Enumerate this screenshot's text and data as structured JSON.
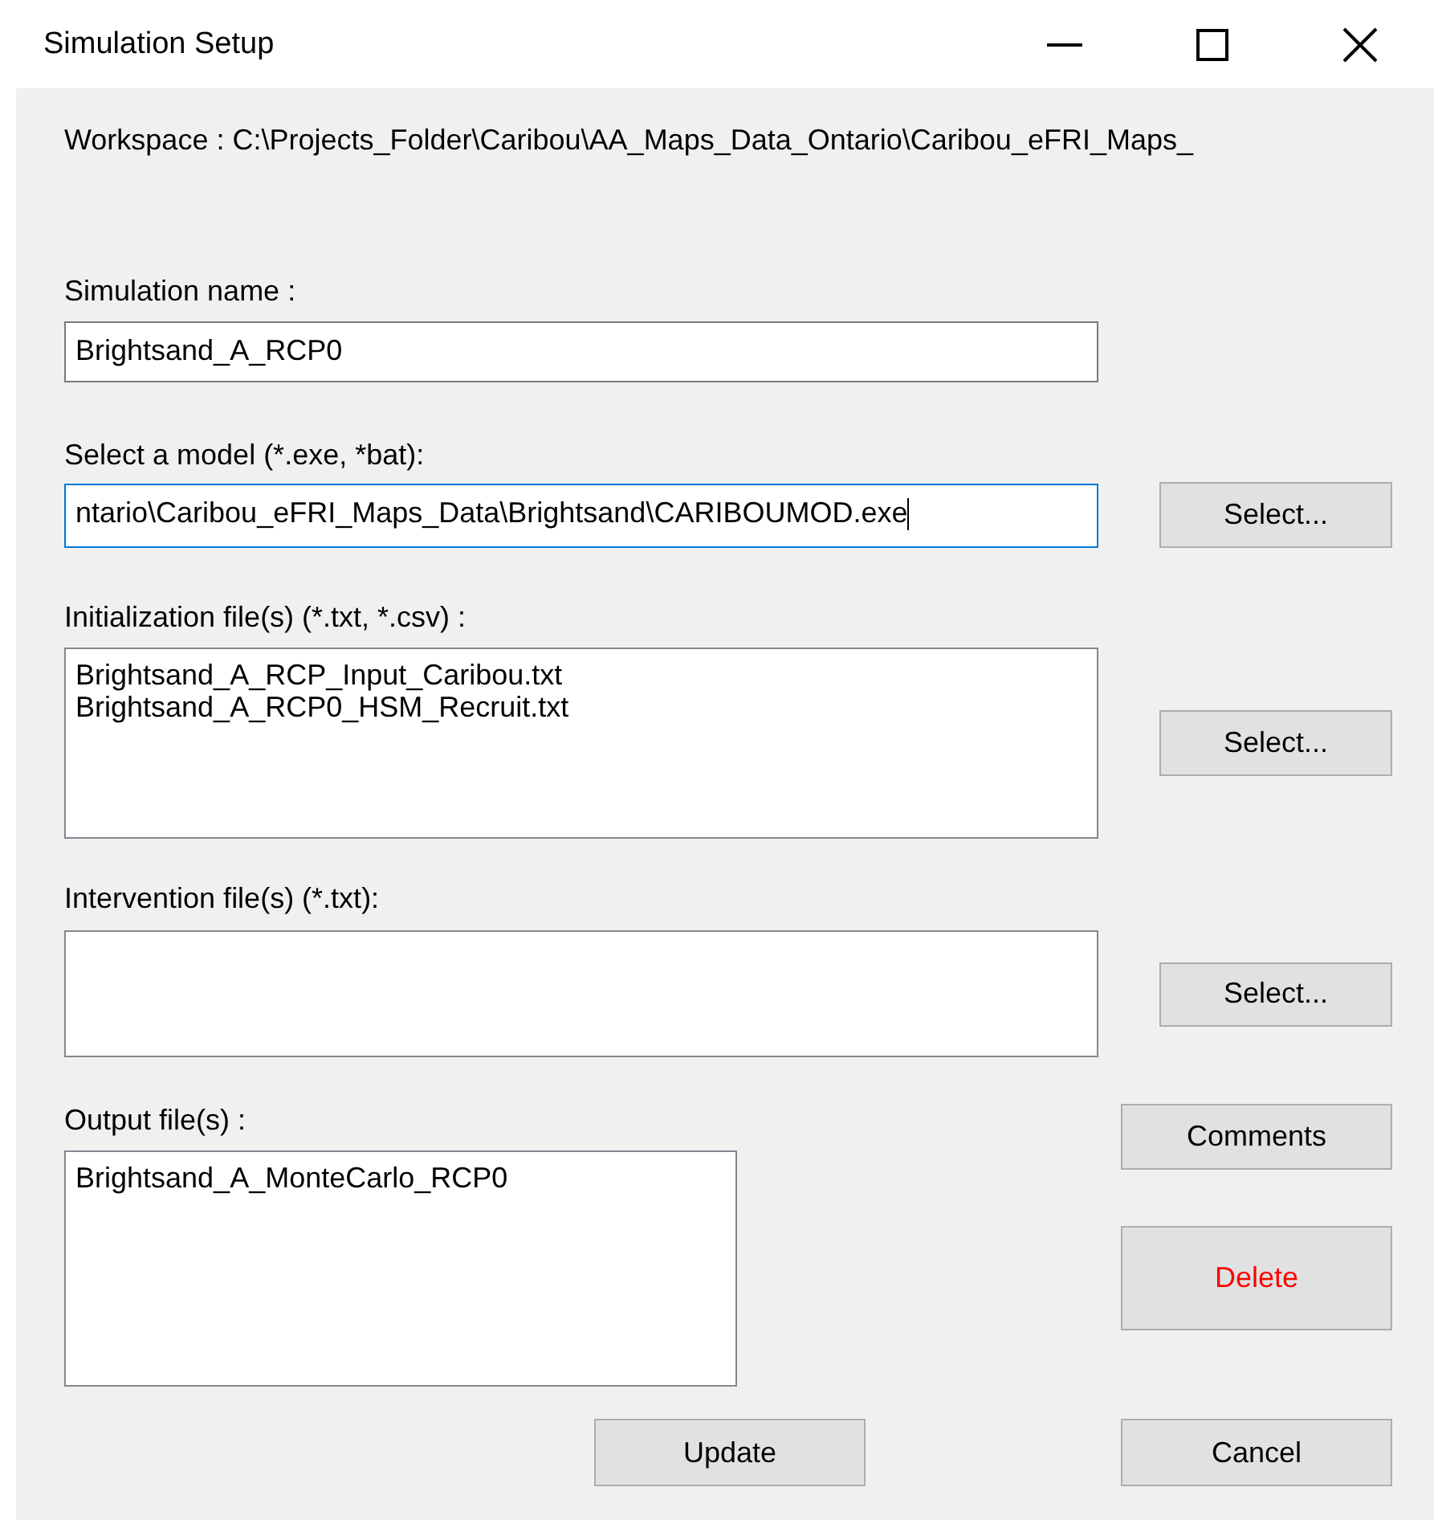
{
  "window": {
    "title": "Simulation Setup"
  },
  "workspace": "Workspace : C:\\Projects_Folder\\Caribou\\AA_Maps_Data_Ontario\\Caribou_eFRI_Maps_",
  "simulation_name": {
    "label": "Simulation name :",
    "value": "Brightsand_A_RCP0",
    "focused": false
  },
  "model": {
    "label": "Select a model (*.exe, *bat):",
    "value": "ntario\\Caribou_eFRI_Maps_Data\\Brightsand\\CARIBOUMOD.exe",
    "focused": true,
    "button": "Select..."
  },
  "initialization": {
    "label": "Initialization file(s) (*.txt, *.csv) :",
    "items": [
      "Brightsand_A_RCP_Input_Caribou.txt",
      "Brightsand_A_RCP0_HSM_Recruit.txt"
    ],
    "button": "Select..."
  },
  "intervention": {
    "label": "Intervention file(s) (*.txt):",
    "button": "Select..."
  },
  "output": {
    "label": "Output file(s) :",
    "items": [
      "Brightsand_A_MonteCarlo_RCP0"
    ]
  },
  "side_buttons": [
    {
      "label": "Comments",
      "kind": "normal"
    },
    {
      "label": "Delete",
      "kind": "danger"
    }
  ],
  "bottom_buttons": [
    {
      "label": "Update"
    },
    {
      "label": "Cancel"
    }
  ]
}
